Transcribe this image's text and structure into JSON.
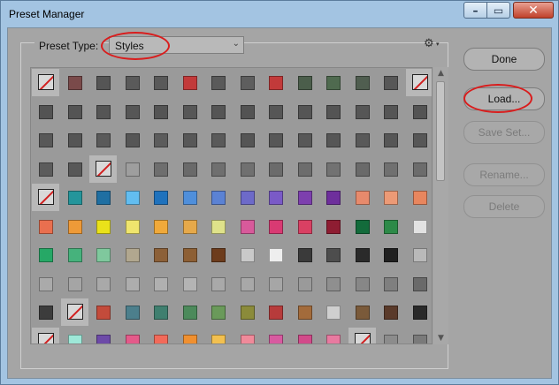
{
  "window": {
    "title": "Preset Manager"
  },
  "window_controls": {
    "minimize": "minimize-icon",
    "maximize": "maximize-icon",
    "close": "close-icon"
  },
  "preset_type": {
    "label": "Preset Type:",
    "selected": "Styles",
    "options": [
      "Styles"
    ]
  },
  "menu": {
    "icon": "gear-icon"
  },
  "buttons": {
    "done": "Done",
    "load": "Load...",
    "save_set": "Save Set...",
    "rename": "Rename...",
    "delete": "Delete"
  },
  "button_states": {
    "done": "enabled",
    "load": "enabled",
    "save_set": "disabled",
    "rename": "disabled",
    "delete": "disabled"
  },
  "annotation_color": "#d91d1d",
  "grid": {
    "columns": 14,
    "visible_rows": 10,
    "rows": [
      [
        "none",
        "#7a4a4a",
        "#555555",
        "#5a5a5a",
        "#595959",
        "#c23a3a",
        "#5a5a5a",
        "#5e5e5e",
        "#c23a3a",
        "#4b5e4b",
        "#4f6a4f",
        "#505e50",
        "#575757",
        "none"
      ],
      [
        "#535353",
        "#545454",
        "#555555",
        "#565656",
        "#545454",
        "#575757",
        "#555555",
        "#535353",
        "#565656",
        "#555555",
        "#545454",
        "#565656",
        "#555555",
        "#545454"
      ],
      [
        "#585858",
        "#555555",
        "#5a5a5a",
        "#565656",
        "#5c5c5c",
        "#585858",
        "#5a5a5a",
        "#555555",
        "#575757",
        "#585858",
        "#565656",
        "#595959",
        "#565656",
        "#575757"
      ],
      [
        "#5c5c5c",
        "#585858",
        "none",
        "#9e9e9e",
        "#6e6e6e",
        "#6a6a6a",
        "#6f6f6f",
        "#707070",
        "#6b6b6b",
        "#6d6d6d",
        "#727272",
        "#6a6a6a",
        "#707070",
        "#6c6c6c"
      ],
      [
        "none",
        "#24959b",
        "#1f6fa2",
        "#62bdf0",
        "#1f72bd",
        "#4f8fdb",
        "#5b82d4",
        "#6d6ac9",
        "#7a5ac7",
        "#7d3fae",
        "#6e2f9c",
        "#e78a6c",
        "#ec9a76",
        "#e8865e"
      ],
      [
        "#e96f4f",
        "#ee9a38",
        "#eae21a",
        "#efe56d",
        "#f0a93a",
        "#e6a94a",
        "#dfe28a",
        "#d85a9b",
        "#d93a73",
        "#d94063",
        "#8e1d32",
        "#136b3b",
        "#2d8a48",
        "#e2e2e2"
      ],
      [
        "#26a866",
        "#46b27c",
        "#7fc89d",
        "#b1a78f",
        "#8c6038",
        "#8d5f34",
        "#6d3c1c",
        "#c9c9c9",
        "#eeeeee",
        "#3a3a3a",
        "#4d4d4d",
        "#2a2a2a",
        "#202020",
        "#b9b9b9"
      ],
      [
        "#aaaaaa",
        "#a5a5a5",
        "#a9a9a9",
        "#adadad",
        "#b0b0b0",
        "#b4b4b4",
        "#a9a9a9",
        "#a8a8a8",
        "#a6a6a6",
        "#9a9a9a",
        "#8f8f8f",
        "#878787",
        "#7f7f7f",
        "#6a6a6a"
      ],
      [
        "#3c3c3c",
        "none",
        "#c34b3b",
        "#4c7f8c",
        "#3f7f6f",
        "#4c8a5b",
        "#6a9a5a",
        "#8b8b3a",
        "#b73b3b",
        "#a36b3b",
        "#cfcfcf",
        "#7a5a3a",
        "#5a3a2a",
        "#2a2a2a"
      ],
      [
        "none",
        "#9ee8d8",
        "#6d4aa8",
        "#e45a8a",
        "#f26a5a",
        "#f09030",
        "#f2c050",
        "#f08a9a",
        "#d85aa0",
        "#d24a8a",
        "#e87aa0",
        "none",
        "#8c8c8c",
        "#7a7a7a"
      ]
    ]
  }
}
